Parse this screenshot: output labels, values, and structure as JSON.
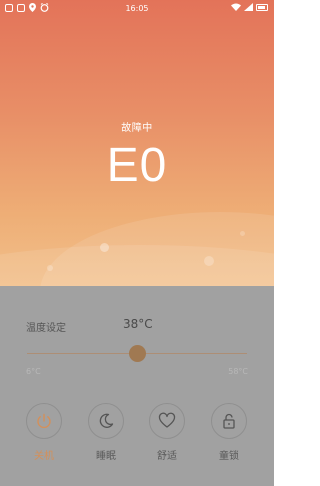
{
  "status_bar": {
    "time": "16:05"
  },
  "device": {
    "status": "故障中",
    "error_code": "E0"
  },
  "temperature": {
    "label": "温度设定",
    "value": "38°C",
    "min_label": "6°C",
    "max_label": "58°C",
    "slider_fraction": 0.5
  },
  "controls": [
    {
      "label": "关机",
      "icon": "power-icon",
      "active": true
    },
    {
      "label": "睡眠",
      "icon": "moon-icon",
      "active": false
    },
    {
      "label": "舒适",
      "icon": "heart-icon",
      "active": false
    },
    {
      "label": "童锁",
      "icon": "lock-icon",
      "active": false
    }
  ],
  "colors": {
    "hero_top": "#e37359",
    "hero_bottom": "#f2c08b",
    "panel": "#a1a1a1",
    "accent": "#d4905a",
    "slider": "#a07952"
  }
}
